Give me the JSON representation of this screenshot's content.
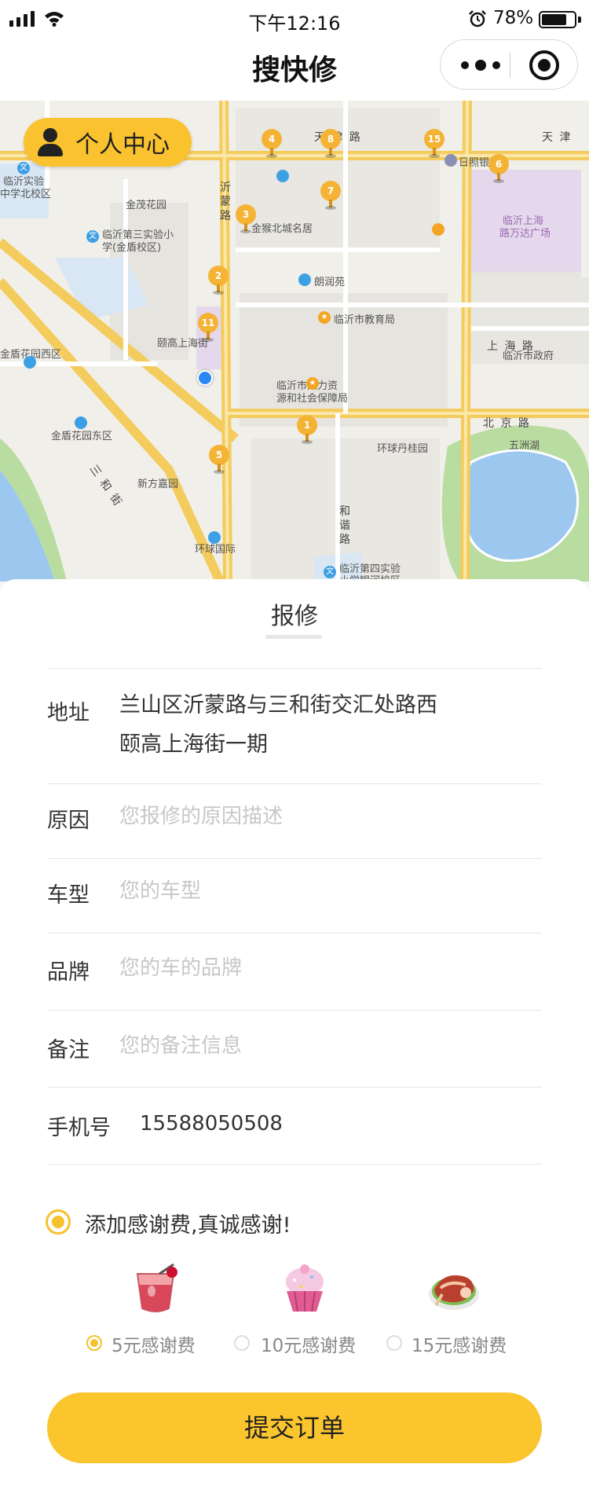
{
  "status_bar": {
    "time": "下午12:16",
    "battery_percent": "78%",
    "battery_level": 0.78
  },
  "nav": {
    "title": "搜快修"
  },
  "map": {
    "personal_center_label": "个人中心",
    "markers": [
      "4",
      "8",
      "15",
      "6",
      "3",
      "7",
      "2",
      "11",
      "1",
      "5"
    ],
    "places": {
      "p1": "临沂实验",
      "p2": "中学北校区",
      "p3": "金茂花园",
      "p4": "临沂第三实验小",
      "p5": "学(金盾校区)",
      "p6": "金盾花园西区",
      "p7": "颐高上海街",
      "p8": "金盾花园东区",
      "p9": "新方嘉园",
      "p10": "环球国际",
      "p11": "金猴北城名居",
      "p12": "朗润苑",
      "p13": "临沂市教育局",
      "p14": "临沂市人力资",
      "p15": "源和社会保障局",
      "p16": "环球丹桂园",
      "p17": "日照银行",
      "p18": "临沂上海",
      "p19": "路万达广场",
      "p20": "临沂市政府",
      "p21": "五洲湖",
      "p22": "临沂第四实验",
      "p23": "小学银河校区"
    },
    "roads": {
      "r1": "天 津 路",
      "r2": "天 津",
      "r3": "北 京 路",
      "r4": "上 海 路",
      "r5": "沂",
      "r6": "蒙",
      "r7": "路",
      "r8": "三 和 街",
      "r9": "和",
      "r10": "谐",
      "r11": "路"
    },
    "colors": {
      "road": "#f3cc5d",
      "water": "#9cc7ef",
      "park": "#b9dca0",
      "marker": "#f5b335",
      "location": "#2b87f5"
    }
  },
  "form": {
    "title": "报修",
    "address": {
      "label": "地址",
      "line1": "兰山区沂蒙路与三和街交汇处路西",
      "line2": "颐高上海街一期"
    },
    "reason": {
      "label": "原因",
      "placeholder": "您报修的原因描述"
    },
    "car_model": {
      "label": "车型",
      "placeholder": "您的车型"
    },
    "brand": {
      "label": "品牌",
      "placeholder": "您的车的品牌"
    },
    "remark": {
      "label": "备注",
      "placeholder": "您的备注信息"
    },
    "phone": {
      "label": "手机号",
      "value": "15588050508"
    },
    "tip": {
      "label": "添加感谢费,真诚感谢!",
      "options": [
        {
          "label": "5元感谢费",
          "selected": true,
          "icon": "drink-icon"
        },
        {
          "label": "10元感谢费",
          "selected": false,
          "icon": "cupcake-icon"
        },
        {
          "label": "15元感谢费",
          "selected": false,
          "icon": "steak-icon"
        }
      ]
    },
    "submit_label": "提交订单"
  },
  "colors": {
    "accent": "#fbc52d",
    "placeholder": "#c7c7c7"
  }
}
